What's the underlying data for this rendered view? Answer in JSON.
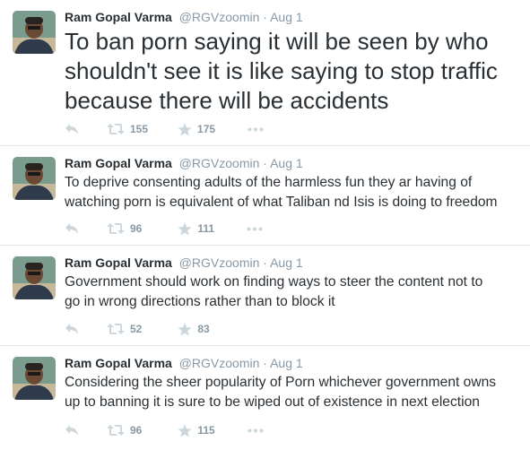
{
  "tweets": [
    {
      "name": "Ram Gopal Varma",
      "handle": "@RGVzoomin",
      "separator": "·",
      "time": "Aug 1",
      "text_lines": [
        "To ban porn saying it will be seen by who",
        "shouldn't see it is like saying to stop traffic",
        "because there will be accidents"
      ],
      "retweets": "155",
      "favorites": "175"
    },
    {
      "name": "Ram Gopal Varma",
      "handle": "@RGVzoomin",
      "separator": "·",
      "time": "Aug 1",
      "text_lines": [
        "To deprive consenting adults of the harmless fun they ar having of",
        "watching porn is equivalent of what Taliban nd Isis is doing to freedom"
      ],
      "retweets": "96",
      "favorites": "111"
    },
    {
      "name": "Ram Gopal Varma",
      "handle": "@RGVzoomin",
      "separator": "·",
      "time": "Aug 1",
      "text_lines": [
        "Government should work on finding ways to steer the content not to",
        "go in wrong directions rather than to block it"
      ],
      "retweets": "52",
      "favorites": "83"
    },
    {
      "name": "Ram Gopal Varma",
      "handle": "@RGVzoomin",
      "separator": "·",
      "time": "Aug 1",
      "text_lines": [
        "Considering the sheer popularity of Porn whichever government owns",
        "up to banning it is sure to be wiped out of existence in next election"
      ],
      "retweets": "96",
      "favorites": "115"
    }
  ],
  "icons": {
    "reply": "reply-icon",
    "retweet": "retweet-icon",
    "favorite": "star-icon",
    "more": "more-icon"
  },
  "colors": {
    "text": "#292f33",
    "muted": "#8899a6",
    "icon": "#ccd6dd",
    "divider": "#e1e8ed"
  }
}
